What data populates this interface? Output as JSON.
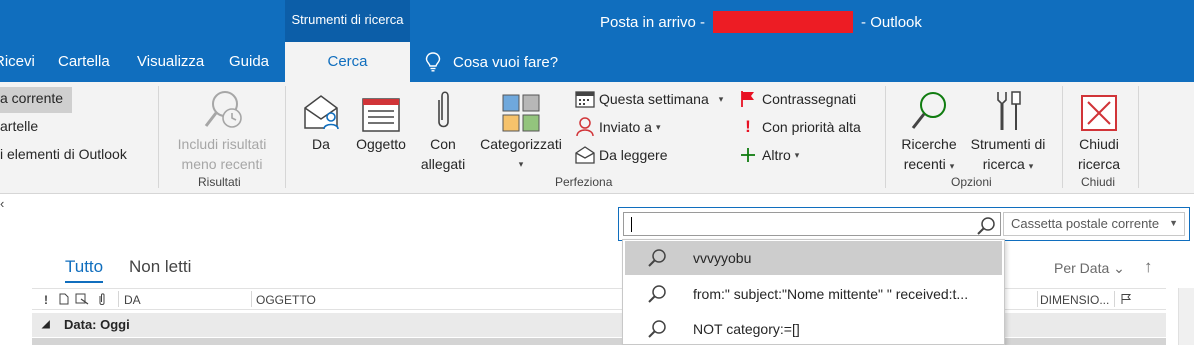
{
  "titlebar": {
    "context_group": "Strumenti di ricerca",
    "title_left": "Posta in arrivo -",
    "title_right": "- Outlook"
  },
  "tabs": {
    "ricevi": "Ricevi",
    "cartella": "Cartella",
    "visualizza": "Visualizza",
    "guida": "Guida",
    "cerca": "Cerca",
    "tell_me": "Cosa vuoi fare?"
  },
  "ribbon": {
    "scope": {
      "current": "a corrente",
      "subfolders": "artelle",
      "all_items": "i elementi di Outlook"
    },
    "results": {
      "include_older_line1": "Includi risultati",
      "include_older_line2": "meno recenti",
      "group_label": "Risultati"
    },
    "refine": {
      "da": "Da",
      "oggetto": "Oggetto",
      "con_allegati_line1": "Con",
      "con_allegati_line2": "allegati",
      "categorizzati": "Categorizzati",
      "questa_settimana": "Questa settimana",
      "inviato_a": "Inviato a",
      "da_leggere": "Da leggere",
      "contrassegnati": "Contrassegnati",
      "con_priorita_alta": "Con priorità alta",
      "altro": "Altro",
      "group_label": "Perfeziona"
    },
    "options": {
      "ricerche_line1": "Ricerche",
      "ricerche_line2": "recenti",
      "strumenti_line1": "Strumenti di",
      "strumenti_line2": "ricerca",
      "group_label": "Opzioni"
    },
    "close": {
      "chiudi_line1": "Chiudi",
      "chiudi_line2": "ricerca",
      "group_label": "Chiudi"
    }
  },
  "search": {
    "query": "",
    "scope_value": "Cassetta postale corrente"
  },
  "suggestions": [
    {
      "text": "vvvyyobu"
    },
    {
      "text": "from:\" subject:\"Nome mittente\" \" received:t..."
    },
    {
      "text": "NOT category:=[]"
    }
  ],
  "mail_list": {
    "filter_all": "Tutto",
    "filter_unread": "Non letti",
    "sort_label": "Per Data",
    "columns": {
      "da": "DA",
      "oggetto": "OGGETTO",
      "dimensione": "DIMENSIO..."
    },
    "group_header": "Data: Oggi"
  },
  "colors": {
    "accent": "#106ebe",
    "context_tab": "#0c5ea8",
    "ribbon_bg": "#f3f3f3",
    "redaction": "#ed1c24",
    "flag_red": "#e81123",
    "add_green": "#107c10"
  }
}
